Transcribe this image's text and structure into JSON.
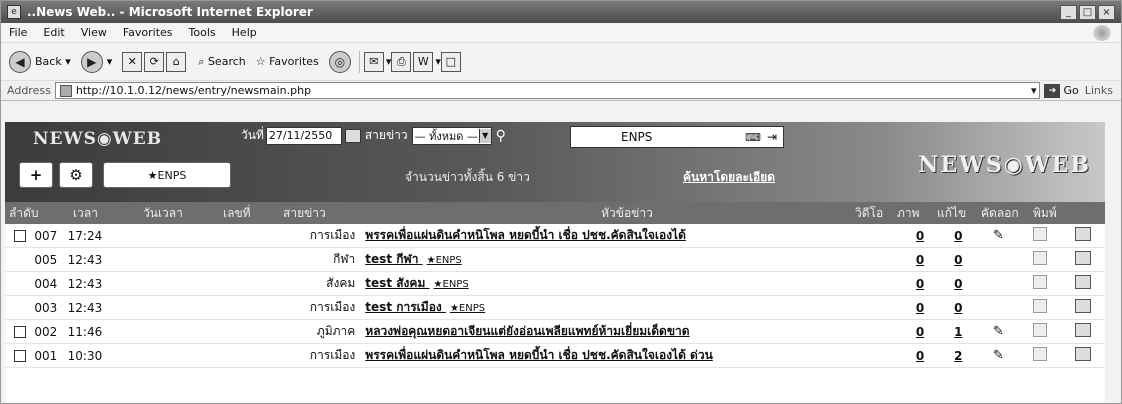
{
  "window": {
    "title": "..News Web.. - Microsoft Internet Explorer"
  },
  "menu": [
    "File",
    "Edit",
    "View",
    "Favorites",
    "Tools",
    "Help"
  ],
  "toolbar": {
    "back": "Back",
    "search": "Search",
    "favorites": "Favorites"
  },
  "address": {
    "label": "Address",
    "url": "http://10.1.0.12/news/entry/newsmain.php",
    "go": "Go",
    "links": "Links"
  },
  "header": {
    "logo": "NEWS◉WEB",
    "logo_right": "NEWS◉WEB",
    "date_label": "วันที่",
    "date_value": "27/11/2550",
    "category_label": "สายข่าว",
    "category_value": "— ทั้งหมด —",
    "enps_label": "ENPS",
    "tab_enps": "★ENPS",
    "total_text": "จำนวนข่าวทั้งสิ้น 6 ข่าว",
    "advanced_search": "ค้นหาโดยละเอียด"
  },
  "columns": {
    "seq": "ลำดับ",
    "time": "เวลา",
    "updated": "วันเวลา",
    "number": "เลขที่",
    "category": "สายข่าว",
    "headline": "หัวข้อข่าว",
    "video": "วิดีโอ",
    "photo": "ภาพ",
    "edit": "แก้ไข",
    "copy": "คัดลอก",
    "print": "พิมพ์"
  },
  "rows": [
    {
      "no": "007",
      "time": "17:24",
      "category": "การเมือง",
      "title": "พรรคเพื่อแผ่นดินคำหนิโพล หยดบี้นำ เชื่อ ปชช.คัดสินใจเองได้",
      "enps": "",
      "video": "0",
      "photo": "0",
      "has_checkbox": true,
      "editable": true
    },
    {
      "no": "005",
      "time": "12:43",
      "category": "กีฬา",
      "title": "test กีฬา",
      "enps": "★ENPS",
      "video": "0",
      "photo": "0",
      "has_checkbox": false,
      "editable": false
    },
    {
      "no": "004",
      "time": "12:43",
      "category": "สังคม",
      "title": "test สังคม",
      "enps": "★ENPS",
      "video": "0",
      "photo": "0",
      "has_checkbox": false,
      "editable": false
    },
    {
      "no": "003",
      "time": "12:43",
      "category": "การเมือง",
      "title": "test การเมือง",
      "enps": "★ENPS",
      "video": "0",
      "photo": "0",
      "has_checkbox": false,
      "editable": false
    },
    {
      "no": "002",
      "time": "11:46",
      "category": "ภูมิภาค",
      "title": "หลวงพ่อคุณหยดอาเจียนแต่ยังอ่อนเพลียแพทย์ห้ามเยี่ยมเด็ดขาด",
      "enps": "",
      "video": "0",
      "photo": "1",
      "has_checkbox": true,
      "editable": true
    },
    {
      "no": "001",
      "time": "10:30",
      "category": "การเมือง",
      "title": "พรรคเพื่อแผ่นดินคำหนิโพล หยดบี้นำ เชื่อ ปชช.คัดสินใจเองได้ ด่วน",
      "enps": "",
      "video": "0",
      "photo": "2",
      "has_checkbox": true,
      "editable": true
    }
  ]
}
